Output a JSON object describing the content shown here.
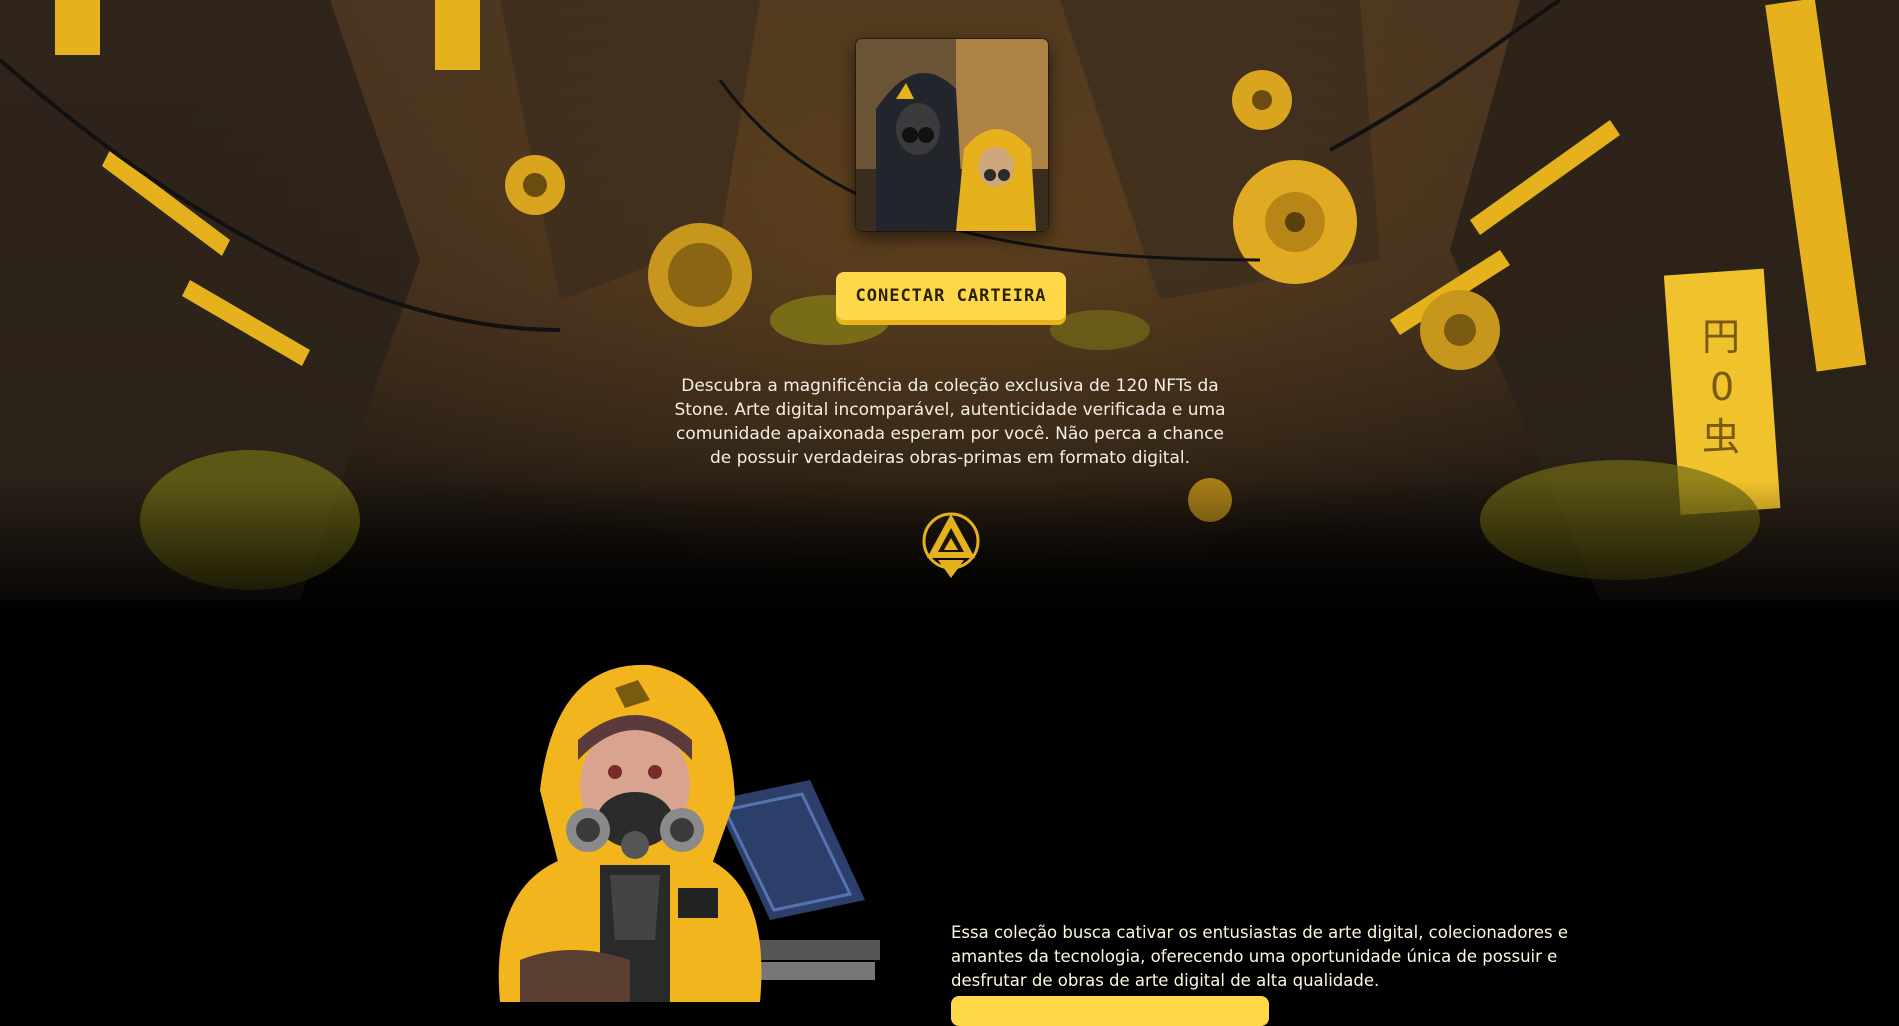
{
  "hero": {
    "connect_button_label": "CONECTAR CARTEIRA",
    "intro_text": "Descubra a magnificência da coleção exclusiva de 120 NFTs da Stone. Arte digital incomparável, autenticidade verificada e uma comunidade apaixonada esperam por você. Não perca a chance de possuir verdadeiras obras-primas em formato digital."
  },
  "about": {
    "text": "Essa coleção busca cativar os entusiastas de arte digital, colecionadores e amantes da tecnologia, oferecendo uma oportunidade única de possuir e desfrutar de obras de arte digital de alta qualidade."
  },
  "colors": {
    "accent": "#ffd84a",
    "background": "#000000"
  },
  "icons": [
    "triangle-emblem-icon"
  ]
}
